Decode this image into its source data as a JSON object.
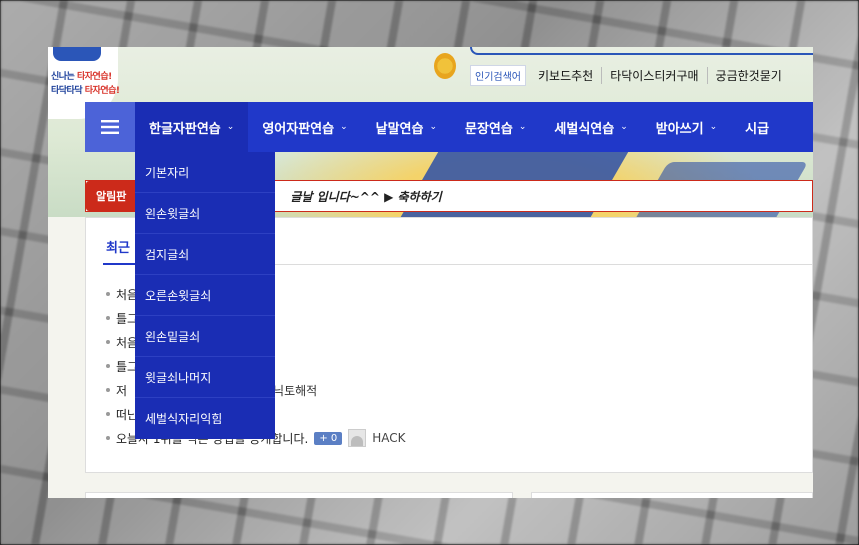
{
  "header": {
    "slogan_1_a": "신나는 ",
    "slogan_1_b": "타자연습!",
    "slogan_2_a": "타닥타닥 ",
    "slogan_2_b": "타자연습!",
    "popular_tag": "인기검색어",
    "links": [
      "키보드추천",
      "타닥이스티커구매",
      "궁금한것묻기"
    ]
  },
  "nav": {
    "items": [
      {
        "label": "한글자판연습",
        "chevron": "⌄"
      },
      {
        "label": "영어자판연습",
        "chevron": "⌄"
      },
      {
        "label": "낱말연습",
        "chevron": "⌄"
      },
      {
        "label": "문장연습",
        "chevron": "⌄"
      },
      {
        "label": "세벌식연습",
        "chevron": "⌄"
      },
      {
        "label": "받아쓰기",
        "chevron": "⌄"
      },
      {
        "label": "시급",
        "chevron": ""
      }
    ],
    "dropdown": [
      "기본자리",
      "왼손윗글쇠",
      "검지글쇠",
      "오른손윗글쇠",
      "왼손밑글쇠",
      "윗글쇠나머지",
      "세벌식자리익힘"
    ]
  },
  "alert": {
    "label": "알림판",
    "text": "글날 입니다~^^ ▶ 축하하기"
  },
  "content": {
    "tab": "최근",
    "posts": [
      {
        "title": "처음",
        "right": "",
        "badge": "",
        "author": ""
      },
      {
        "title": "틀그",
        "right": "",
        "badge": "",
        "author": ""
      },
      {
        "title": "처음",
        "right": "",
        "badge": "",
        "author": ""
      },
      {
        "title": "틀그",
        "right": "",
        "badge": "",
        "author": ""
      },
      {
        "title": "저 ",
        "right": "닉토해적",
        "badge": "",
        "author": ""
      },
      {
        "title": "떠난",
        "right": "",
        "badge": "",
        "author": ""
      },
      {
        "title": "오늘사 1위를 먹은 방법을 공개합니다.",
        "right": "",
        "badge": "+ 0",
        "author": "HACK"
      }
    ]
  },
  "colors": {
    "nav_bg": "#2038c9",
    "dropdown_bg": "#1a2db4",
    "alert_red": "#cc2a1a",
    "brand_blue": "#2b56b8"
  }
}
